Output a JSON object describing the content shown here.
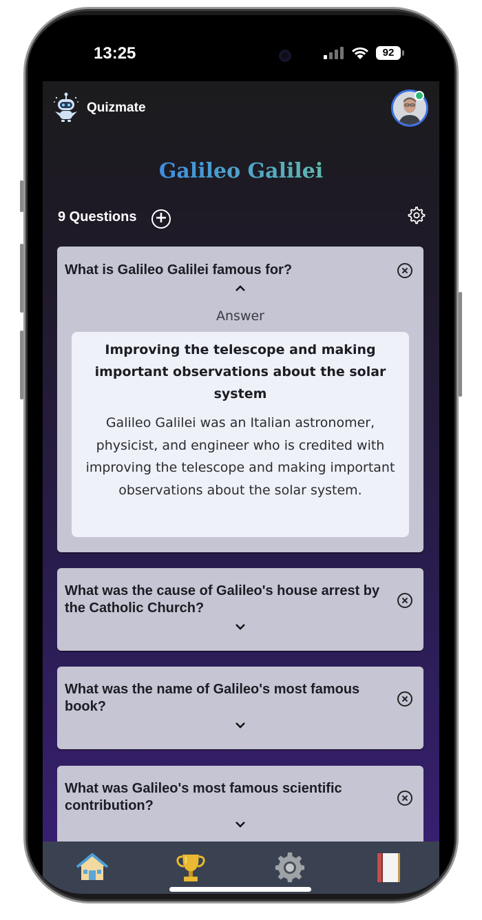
{
  "status_bar": {
    "time": "13:25",
    "battery": "92"
  },
  "app": {
    "name": "Quizmate"
  },
  "quiz": {
    "title": "Galileo Galilei",
    "question_count_label": "9 Questions"
  },
  "cards": [
    {
      "question": "What is Galileo Galilei famous for?",
      "expanded": true,
      "answer_label": "Answer",
      "answer_title": "Improving the telescope and making important observations about the solar system",
      "answer_text": "Galileo Galilei was an Italian astronomer, physicist, and engineer who is credited with improving the telescope and making important observations about the solar system."
    },
    {
      "question": "What was the cause of Galileo's house arrest by the Catholic Church?",
      "expanded": false
    },
    {
      "question": "What was the name of Galileo's most famous book?",
      "expanded": false
    },
    {
      "question": "What was Galileo's most famous scientific contribution?",
      "expanded": false
    }
  ],
  "tabs": [
    {
      "icon": "home-icon"
    },
    {
      "icon": "trophy-icon"
    },
    {
      "icon": "settings-gear-icon"
    },
    {
      "icon": "book-icon"
    }
  ],
  "colors": {
    "title_gradient_start": "#3e8ee0",
    "title_gradient_end": "#5fb8b0",
    "card_bg": "#c5c5d3",
    "answer_bg": "#eef1f7",
    "tabbar_bg": "#3a4150",
    "online_status": "#2bb673"
  }
}
